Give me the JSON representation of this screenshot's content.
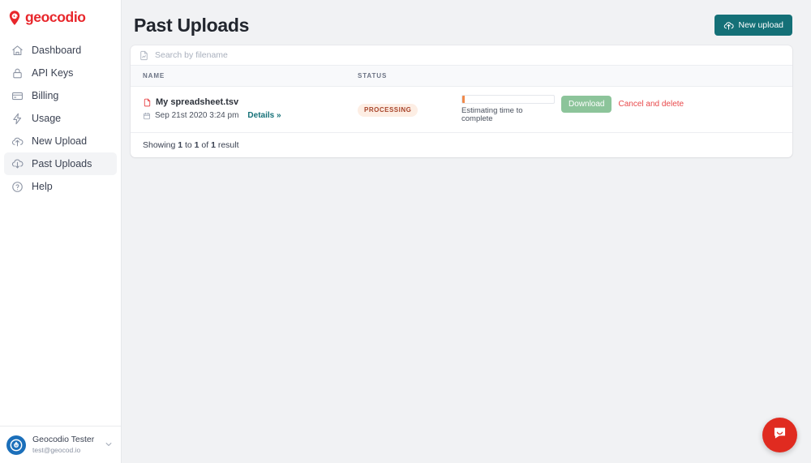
{
  "brand": {
    "name": "geocodio",
    "logo_icon": "geocodio-pin-logo",
    "color": "#e8262b"
  },
  "sidebar": {
    "items": [
      {
        "label": "Dashboard",
        "icon": "home-icon",
        "active": false
      },
      {
        "label": "API Keys",
        "icon": "lock-icon",
        "active": false
      },
      {
        "label": "Billing",
        "icon": "credit-card-icon",
        "active": false
      },
      {
        "label": "Usage",
        "icon": "lightning-bolt-icon",
        "active": false
      },
      {
        "label": "New Upload",
        "icon": "cloud-upload-icon",
        "active": false
      },
      {
        "label": "Past Uploads",
        "icon": "cloud-download-icon",
        "active": true
      },
      {
        "label": "Help",
        "icon": "question-circle-icon",
        "active": false
      }
    ],
    "user": {
      "name": "Geocodio Tester",
      "email": "test@geocod.io",
      "avatar_icon": "user-avatar",
      "chevron_icon": "chevron-down-icon"
    }
  },
  "header": {
    "title": "Past Uploads",
    "new_upload_button": {
      "label": "New upload",
      "icon": "cloud-upload-icon",
      "color": "#147077"
    }
  },
  "search": {
    "placeholder": "Search by filename",
    "value": "",
    "icon": "file-search-icon"
  },
  "table": {
    "columns": [
      "NAME",
      "STATUS",
      ""
    ],
    "rows": [
      {
        "file_icon": "file-tsv-icon",
        "filename": "My spreadsheet.tsv",
        "date_icon": "calendar-icon",
        "date": "Sep 21st 2020 3:24 pm",
        "details_label": "Details »",
        "status": "PROCESSING",
        "status_color": "#a8442a",
        "status_bg": "#fdeee4",
        "progress_percent": 3,
        "progress_label": "Estimating time to complete",
        "progress_color": "#f08a4b",
        "download_label": "Download",
        "download_color": "#8cc49a",
        "cancel_label": "Cancel and delete",
        "cancel_color": "#e8484a"
      }
    ],
    "footer_prefix": "Showing ",
    "footer_from": "1",
    "footer_mid": " to ",
    "footer_to": "1",
    "footer_mid2": " of ",
    "footer_total": "1",
    "footer_suffix": " result"
  },
  "chat": {
    "icon": "chat-bubble-icon",
    "color": "#e02b20"
  }
}
